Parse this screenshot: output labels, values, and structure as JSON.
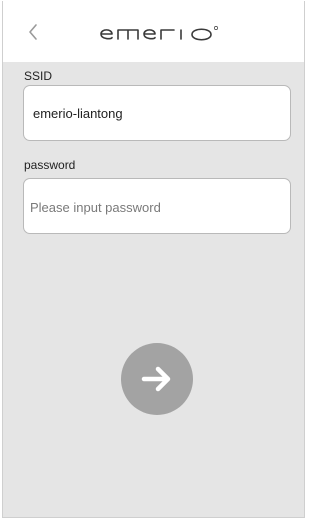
{
  "header": {
    "back_icon": "chevron-left-icon",
    "brand": "emerio"
  },
  "ssid": {
    "label": "SSID",
    "value": "emerio-liantong"
  },
  "password": {
    "label": "password",
    "value": "",
    "placeholder": "Please input password"
  },
  "next_button": {
    "icon": "arrow-right-icon"
  },
  "colors": {
    "background": "#e5e5e5",
    "header": "#ffffff",
    "button": "#a3a3a3",
    "border": "#b9b9b9"
  }
}
